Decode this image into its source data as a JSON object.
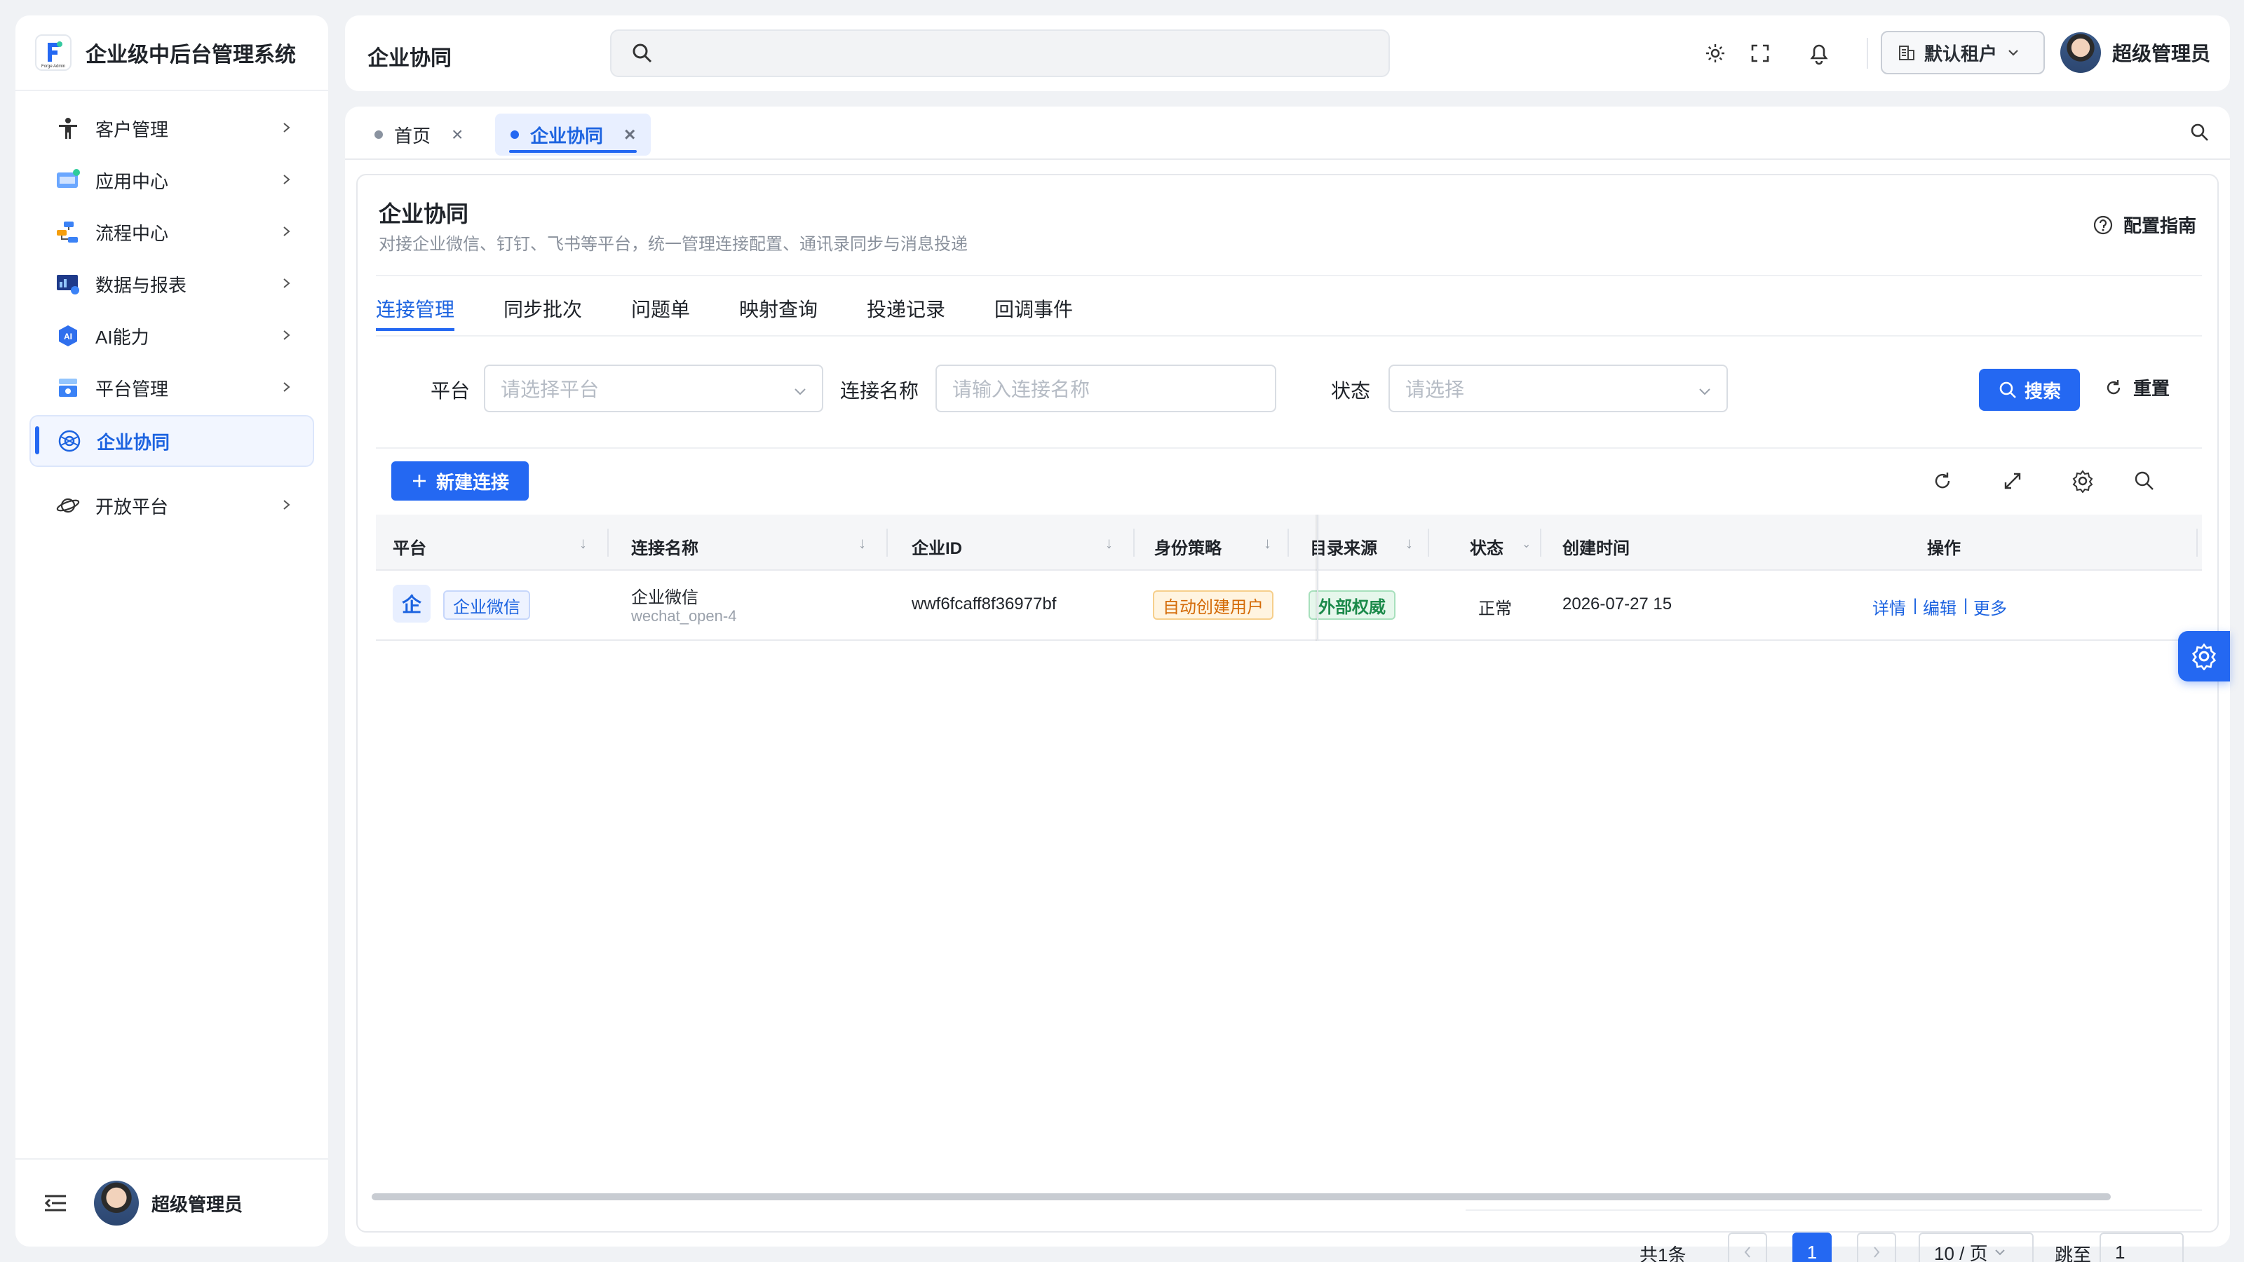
{
  "brand": {
    "title": "企业级中后台管理系统",
    "logo_text": "Forge Admin"
  },
  "sidebar": {
    "items": [
      {
        "label": "客户管理",
        "icon": "person-icon"
      },
      {
        "label": "应用中心",
        "icon": "app-center-icon"
      },
      {
        "label": "流程中心",
        "icon": "flow-icon"
      },
      {
        "label": "数据与报表",
        "icon": "report-icon"
      },
      {
        "label": "AI能力",
        "icon": "ai-icon"
      },
      {
        "label": "平台管理",
        "icon": "platform-icon"
      },
      {
        "label": "企业协同",
        "icon": "collab-icon",
        "active": true
      },
      {
        "label": "开放平台",
        "icon": "planet-icon"
      }
    ],
    "footer_user": "超级管理员"
  },
  "header": {
    "title": "企业协同",
    "search_placeholder": "",
    "tenant": "默认租户",
    "user": "超级管理员"
  },
  "tabs": [
    {
      "label": "首页",
      "active": false
    },
    {
      "label": "企业协同",
      "active": true
    }
  ],
  "page": {
    "title": "企业协同",
    "description": "对接企业微信、钉钉、飞书等平台，统一管理连接配置、通讯录同步与消息投递",
    "guide": "配置指南",
    "subtabs": [
      "连接管理",
      "同步批次",
      "问题单",
      "映射查询",
      "投递记录",
      "回调事件"
    ],
    "active_subtab": "连接管理"
  },
  "filters": {
    "platform_label": "平台",
    "platform_placeholder": "请选择平台",
    "name_label": "连接名称",
    "name_placeholder": "请输入连接名称",
    "status_label": "状态",
    "status_placeholder": "请选择",
    "search_button": "搜索",
    "reset_button": "重置"
  },
  "toolbar": {
    "new_button": "新建连接"
  },
  "table": {
    "columns": [
      "平台",
      "连接名称",
      "企业ID",
      "身份策略",
      "目录来源",
      "状态",
      "创建时间",
      "操作"
    ],
    "rows": [
      {
        "platform_icon": "企",
        "platform": "企业微信",
        "name": "企业微信",
        "code": "wechat_open-4",
        "corp_id": "wwf6fcaff8f36977bf",
        "identity_policy": "自动创建用户",
        "directory_source": "外部权威",
        "status": "正常",
        "created_at": "2026-07-27 15",
        "actions": [
          "详情",
          "编辑",
          "更多"
        ]
      }
    ]
  },
  "pagination": {
    "total": "共1条",
    "current_page": "1",
    "page_size": "10 / 页",
    "jump_label": "跳至",
    "jump_value": "1"
  },
  "colors": {
    "accent": "#2468f2",
    "tag_orange_bg": "#fff4e0",
    "tag_green_bg": "#e6f7ec"
  }
}
